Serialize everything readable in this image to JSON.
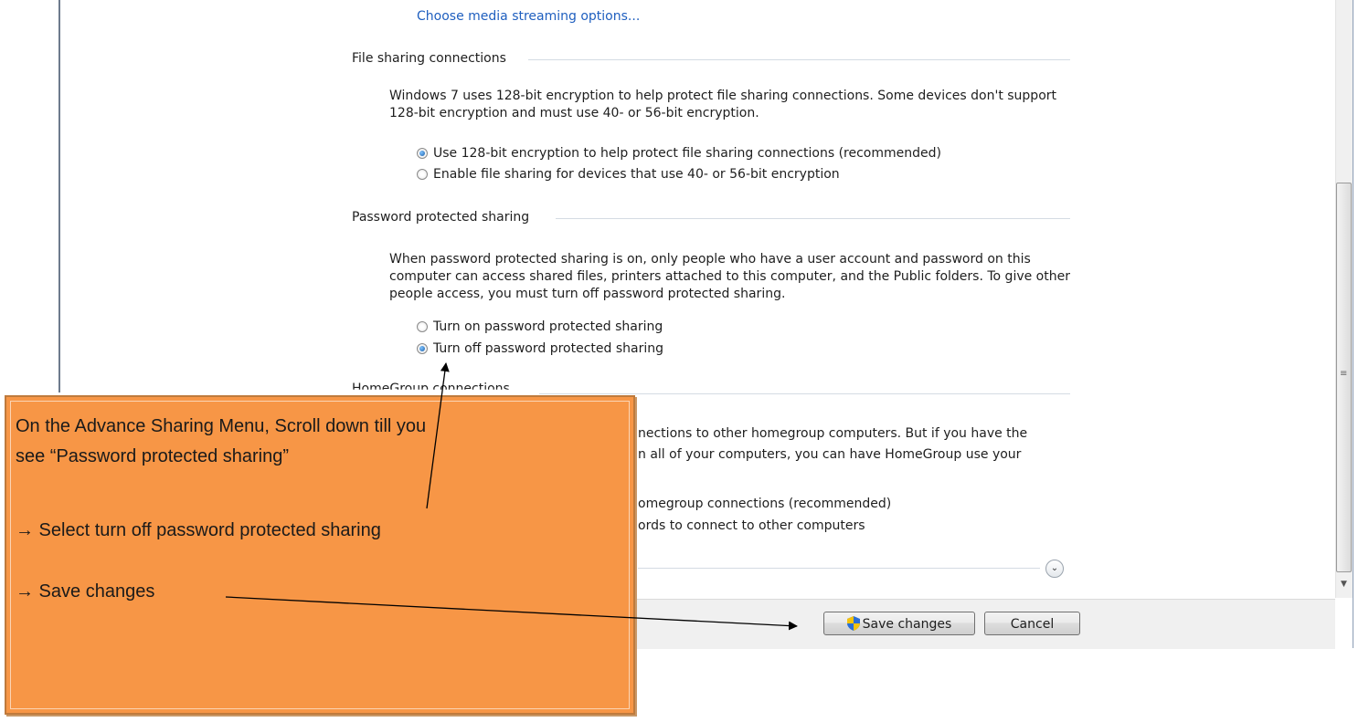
{
  "top_link": "Choose media streaming options...",
  "file_sharing": {
    "title": "File sharing connections",
    "description": "Windows 7 uses 128-bit encryption to help protect file sharing connections. Some devices don't support 128-bit encryption and must use 40- or 56-bit encryption.",
    "options": [
      {
        "label": "Use 128-bit encryption to help protect file sharing connections (recommended)",
        "selected": true
      },
      {
        "label": "Enable file sharing for devices that use 40- or 56-bit encryption",
        "selected": false
      }
    ]
  },
  "password_sharing": {
    "title": "Password protected sharing",
    "description": "When password protected sharing is on, only people who have a user account and password on this computer can access shared files, printers attached to this computer, and the Public folders. To give other people access, you must turn off password protected sharing.",
    "options": [
      {
        "label": "Turn on password protected sharing",
        "selected": false
      },
      {
        "label": "Turn off password protected sharing",
        "selected": true
      }
    ]
  },
  "homegroup": {
    "title_partial": "HomeGroup connections",
    "desc_line1_visible": "nections to other homegroup computers. But if you have the",
    "desc_line2_visible": "n all of your computers, you can have HomeGroup use your",
    "option1_visible": "omegroup connections (recommended)",
    "option2_visible": "ords to connect to other computers"
  },
  "buttons": {
    "save": "Save changes",
    "cancel": "Cancel"
  },
  "callout": {
    "line1": "On the Advance Sharing Menu, Scroll  down till you",
    "line2": "see “Password protected sharing”",
    "line3": "→ Select turn off password protected sharing",
    "line4": "→ Save changes",
    "background": "#f79646"
  },
  "colors": {
    "link": "#1f5fbf",
    "footer": "#f0f0f0"
  }
}
